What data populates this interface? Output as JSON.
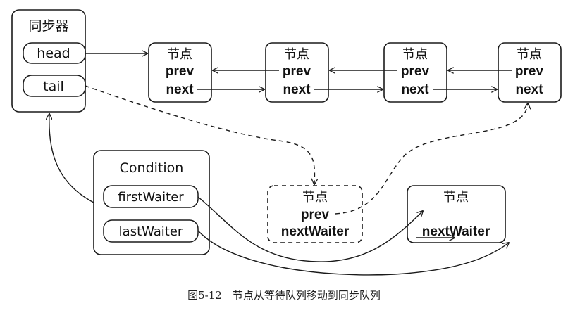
{
  "sync": {
    "title": "同步器",
    "head": "head",
    "tail": "tail"
  },
  "node_label": "节点",
  "prev": "prev",
  "next": "next",
  "nextWaiter": "nextWaiter",
  "condition": {
    "title": "Condition",
    "first": "firstWaiter",
    "last": "lastWaiter"
  },
  "caption": "图5-12　节点从等待队列移动到同步队列"
}
